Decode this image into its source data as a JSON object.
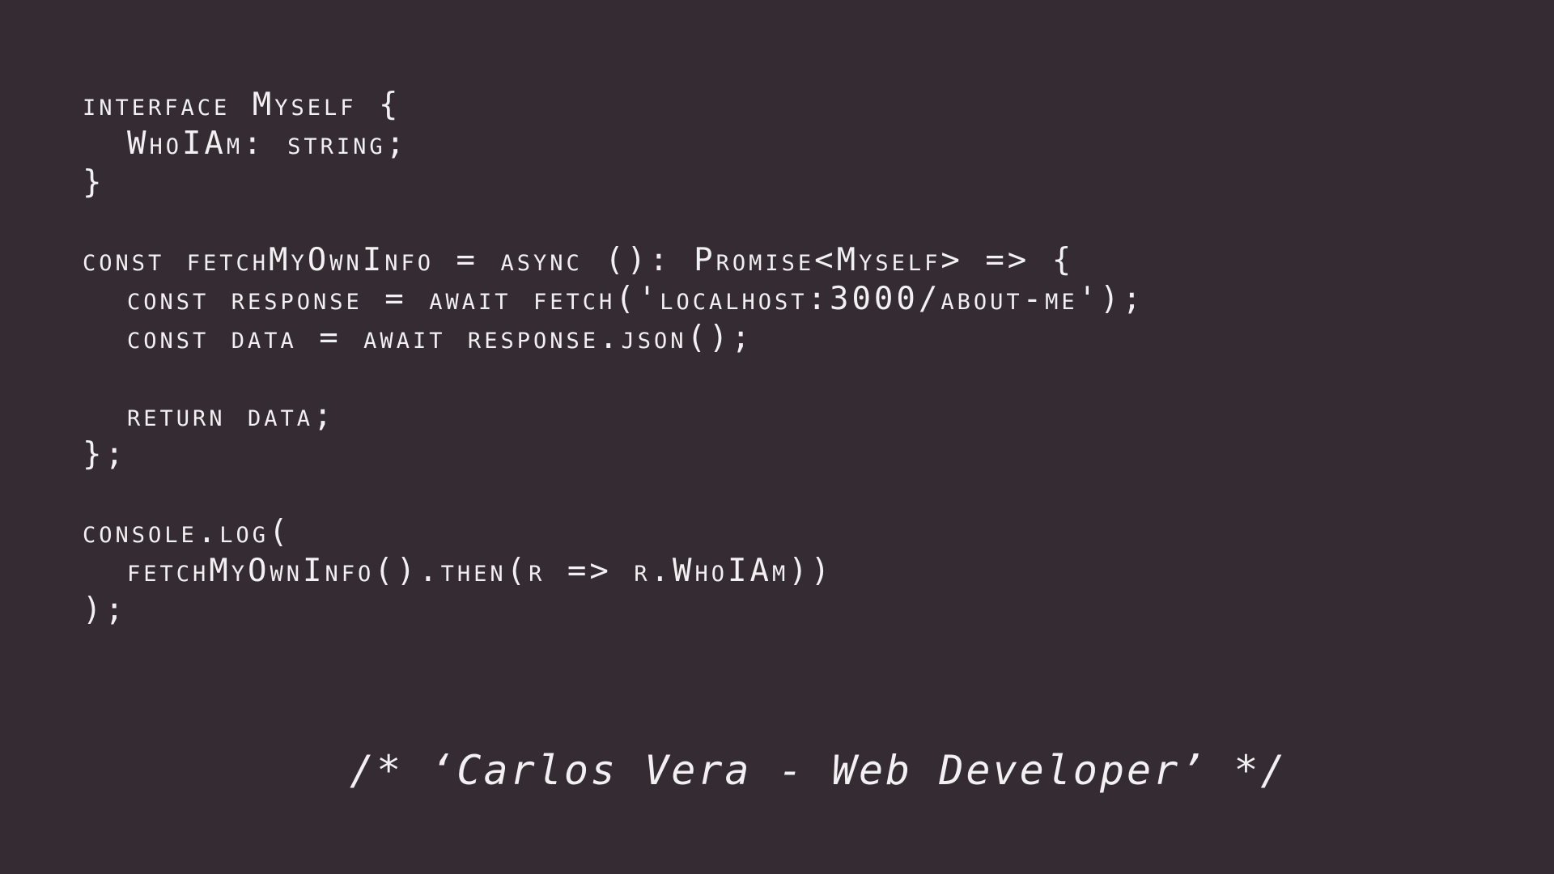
{
  "colors": {
    "background": "#342b33",
    "text": "#f2f0f2"
  },
  "code": {
    "lines": [
      "interface Myself {",
      "  WhoIAm: string;",
      "}",
      "",
      "const fetchMyOwnInfo = async (): Promise<Myself> => {",
      "  const response = await fetch('localhost:3000/about-me');",
      "  const data = await response.json();",
      "",
      "  return data;",
      "};",
      "",
      "console.log(",
      "  fetchMyOwnInfo().then(r => r.WhoIAm))",
      ");"
    ]
  },
  "signature": {
    "text": "/* ‘Carlos Vera - Web Developer’ */"
  }
}
